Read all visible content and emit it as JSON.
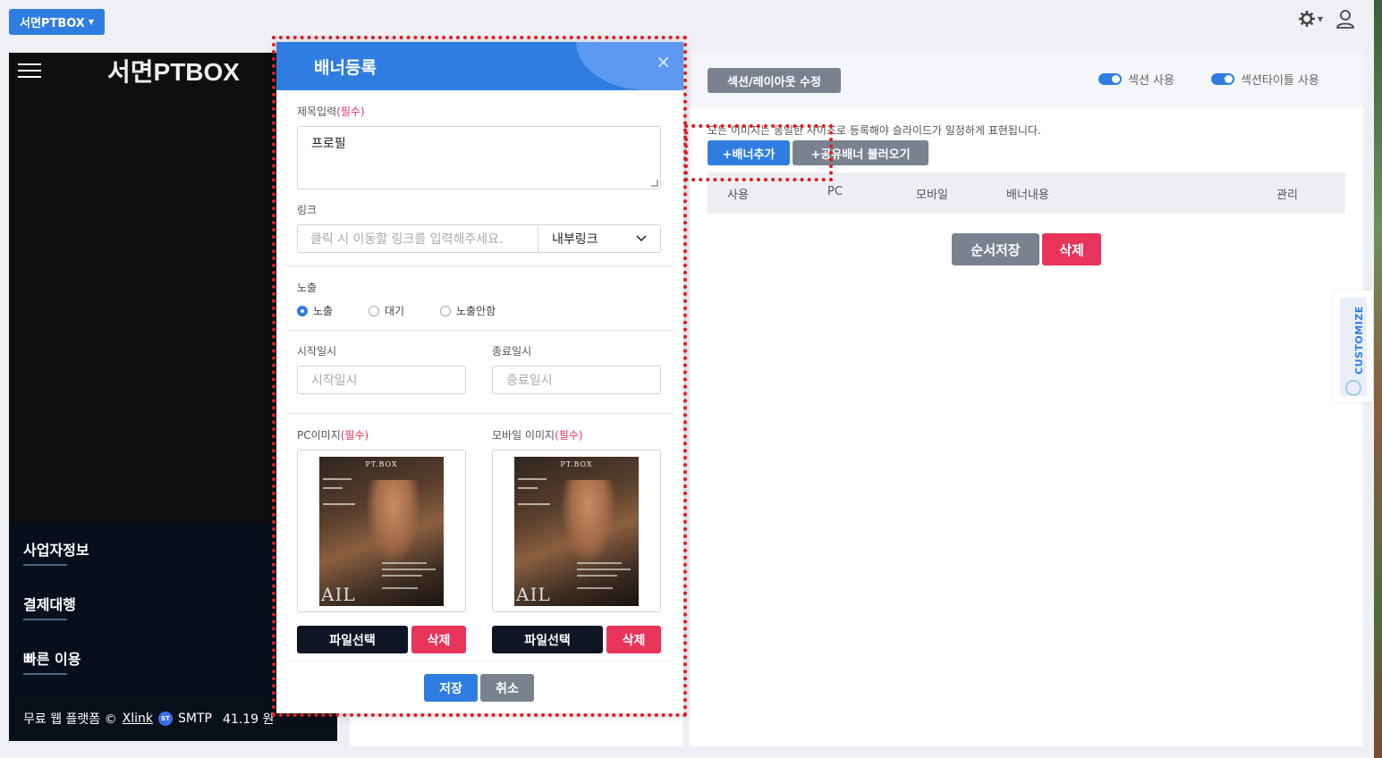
{
  "topbar": {
    "site_button_label": "서면PTBOX"
  },
  "preview": {
    "logo": "서면PTBOX",
    "menu": [
      "사업자정보",
      "결제대행",
      "빠른 이용"
    ],
    "footer": {
      "text": "무료 웹 플랫폼 ©",
      "link": "Xlink",
      "smtp_badge": "ST",
      "smtp_label": "SMTP",
      "balance": "41.19 원"
    }
  },
  "section": {
    "layout_button": "섹션/레이아웃 수정",
    "toggle_section": "섹션 사용",
    "toggle_section_title": "섹션타이틀 사용",
    "notice": "모든 이미지는 동일한 사이즈로 등록해야 슬라이드가 일정하게 표현됩니다.",
    "add_banner": "+배너추가",
    "shared_banner": "+공유배너 불러오기",
    "table_headers": [
      "사용",
      "PC",
      "모바일",
      "배너내용",
      "관리"
    ],
    "order_save": "순서저장",
    "delete": "삭제"
  },
  "customize": {
    "label": "CUSTOMIZE"
  },
  "modal": {
    "title": "배너등록",
    "close": "×",
    "title_label": "제목입력",
    "required": "(필수)",
    "title_value": "프로필",
    "link_label": "링크",
    "link_placeholder": "클릭 시 이동할 링크를 입력해주세요.",
    "link_type": "내부링크",
    "exposure_label": "노출",
    "exposure_options": [
      "노출",
      "대기",
      "노출안함"
    ],
    "exposure_selected": "노출",
    "start_label": "시작일시",
    "start_placeholder": "시작일시",
    "end_label": "종료일시",
    "end_placeholder": "종료일시",
    "pc_image_label": "PC이미지",
    "mobile_image_label": "모바일 이미지",
    "poster_top": "PT.BOX",
    "poster_bottom": "AIL",
    "file_select": "파일선택",
    "file_delete": "삭제",
    "save": "저장",
    "cancel": "취소"
  },
  "colors": {
    "primary": "#2f7de1",
    "danger": "#e8345a",
    "dark": "#0f1524",
    "highlight": "#e01c24"
  }
}
